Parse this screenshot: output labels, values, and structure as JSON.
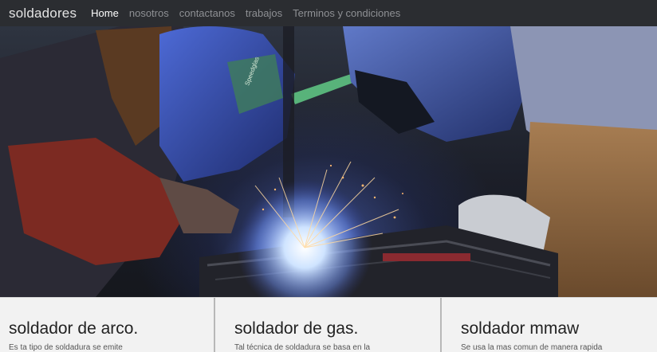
{
  "navbar": {
    "brand": "soldadores",
    "items": [
      {
        "label": "Home",
        "active": true
      },
      {
        "label": "nosotros"
      },
      {
        "label": "contactanos"
      },
      {
        "label": "trabajos"
      },
      {
        "label": "Terminos y condiciones"
      }
    ]
  },
  "hero": {
    "image": "welders-photo",
    "helmet_label": "Speedglas"
  },
  "cards": [
    {
      "title": "soldador de arco.",
      "text": "Es ta tipo de soldadura se emite"
    },
    {
      "title": "soldador de gas.",
      "text": "Tal técnica de soldadura se basa en la"
    },
    {
      "title": "soldador mmaw",
      "text": "Se usa la mas comun de manera rapida"
    }
  ],
  "colors": {
    "navbar": "#2b2d31",
    "nav_active": "#ffffff",
    "nav_inactive": "#8e9094",
    "card_bg": "#f2f2f2"
  }
}
